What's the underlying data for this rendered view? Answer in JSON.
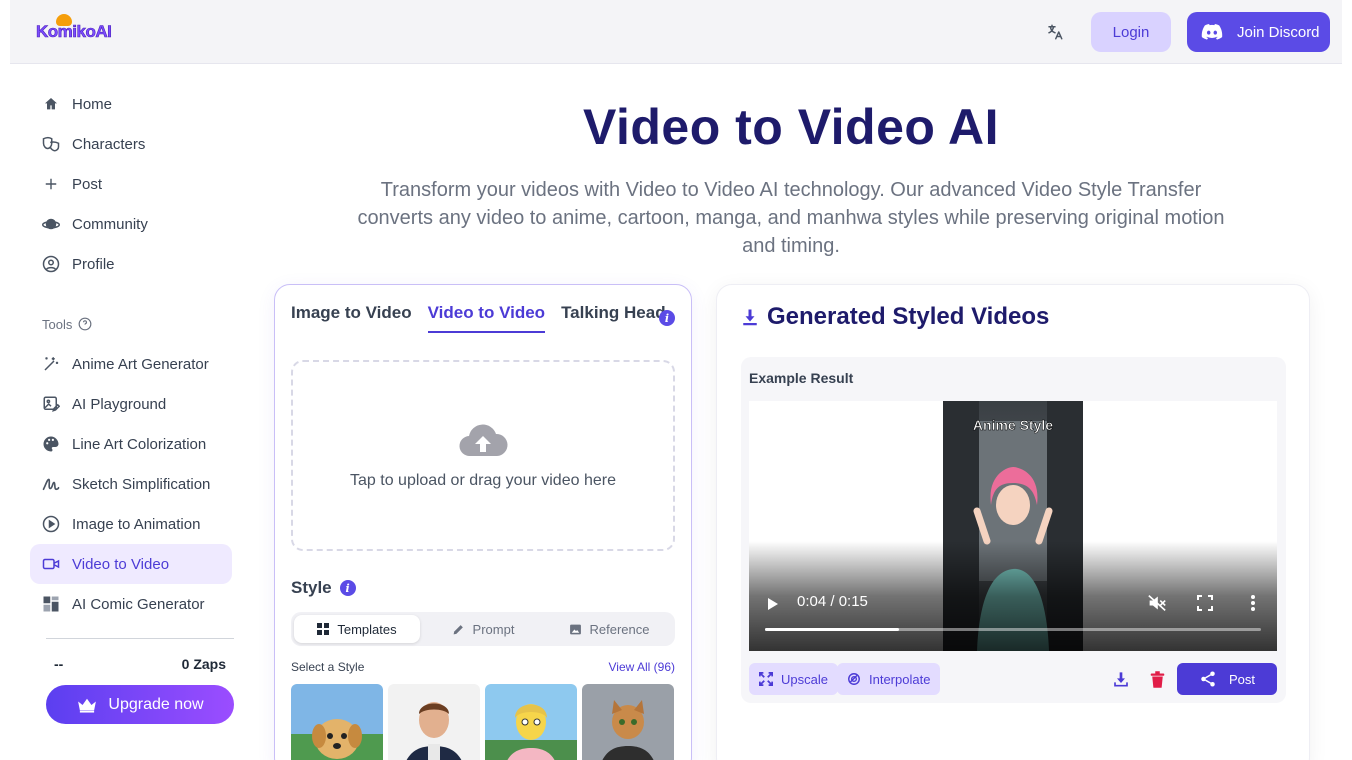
{
  "header": {
    "logo_text": "KomikoAI",
    "login_label": "Login",
    "discord_label": "Join Discord"
  },
  "sidebar": {
    "items": [
      {
        "label": "Home",
        "icon": "home-icon"
      },
      {
        "label": "Characters",
        "icon": "masks-icon"
      },
      {
        "label": "Post",
        "icon": "plus-icon"
      },
      {
        "label": "Community",
        "icon": "planet-icon"
      },
      {
        "label": "Profile",
        "icon": "user-circle-icon"
      }
    ],
    "tools_label": "Tools",
    "tools": [
      {
        "label": "Anime Art Generator",
        "icon": "magic-wand-icon"
      },
      {
        "label": "AI Playground",
        "icon": "image-edit-icon"
      },
      {
        "label": "Line Art Colorization",
        "icon": "palette-icon"
      },
      {
        "label": "Sketch Simplification",
        "icon": "sketch-icon"
      },
      {
        "label": "Image to Animation",
        "icon": "play-circle-icon"
      },
      {
        "label": "Video to Video",
        "icon": "video-camera-icon",
        "active": true
      },
      {
        "label": "AI Comic Generator",
        "icon": "comic-grid-icon"
      }
    ],
    "zaps_left": "--",
    "zaps_right": "0 Zaps",
    "upgrade_label": "Upgrade now"
  },
  "hero": {
    "title": "Video to Video AI",
    "subtitle": "Transform your videos with Video to Video AI technology. Our advanced Video Style Transfer converts any video to anime, cartoon, manga, and manhwa styles while preserving original motion and timing."
  },
  "left_panel": {
    "tabs": [
      {
        "label": "Image to Video"
      },
      {
        "label": "Video to Video",
        "active": true
      },
      {
        "label": "Talking Head"
      }
    ],
    "upload_text": "Tap to upload or drag your video here",
    "style_label": "Style",
    "segments": [
      {
        "label": "Templates",
        "active": true
      },
      {
        "label": "Prompt"
      },
      {
        "label": "Reference"
      }
    ],
    "select_label": "Select a Style",
    "view_all_label": "View All (96)"
  },
  "right_panel": {
    "title": "Generated Styled Videos",
    "example_label": "Example Result",
    "video_caption": "Anime Style",
    "video_time": "0:04 / 0:15",
    "video_progress": 0.27,
    "upscale_label": "Upscale",
    "interpolate_label": "Interpolate",
    "post_label": "Post"
  },
  "colors": {
    "accent": "#4c3bd6",
    "title": "#1e1b6b",
    "delete": "#e11d48"
  }
}
